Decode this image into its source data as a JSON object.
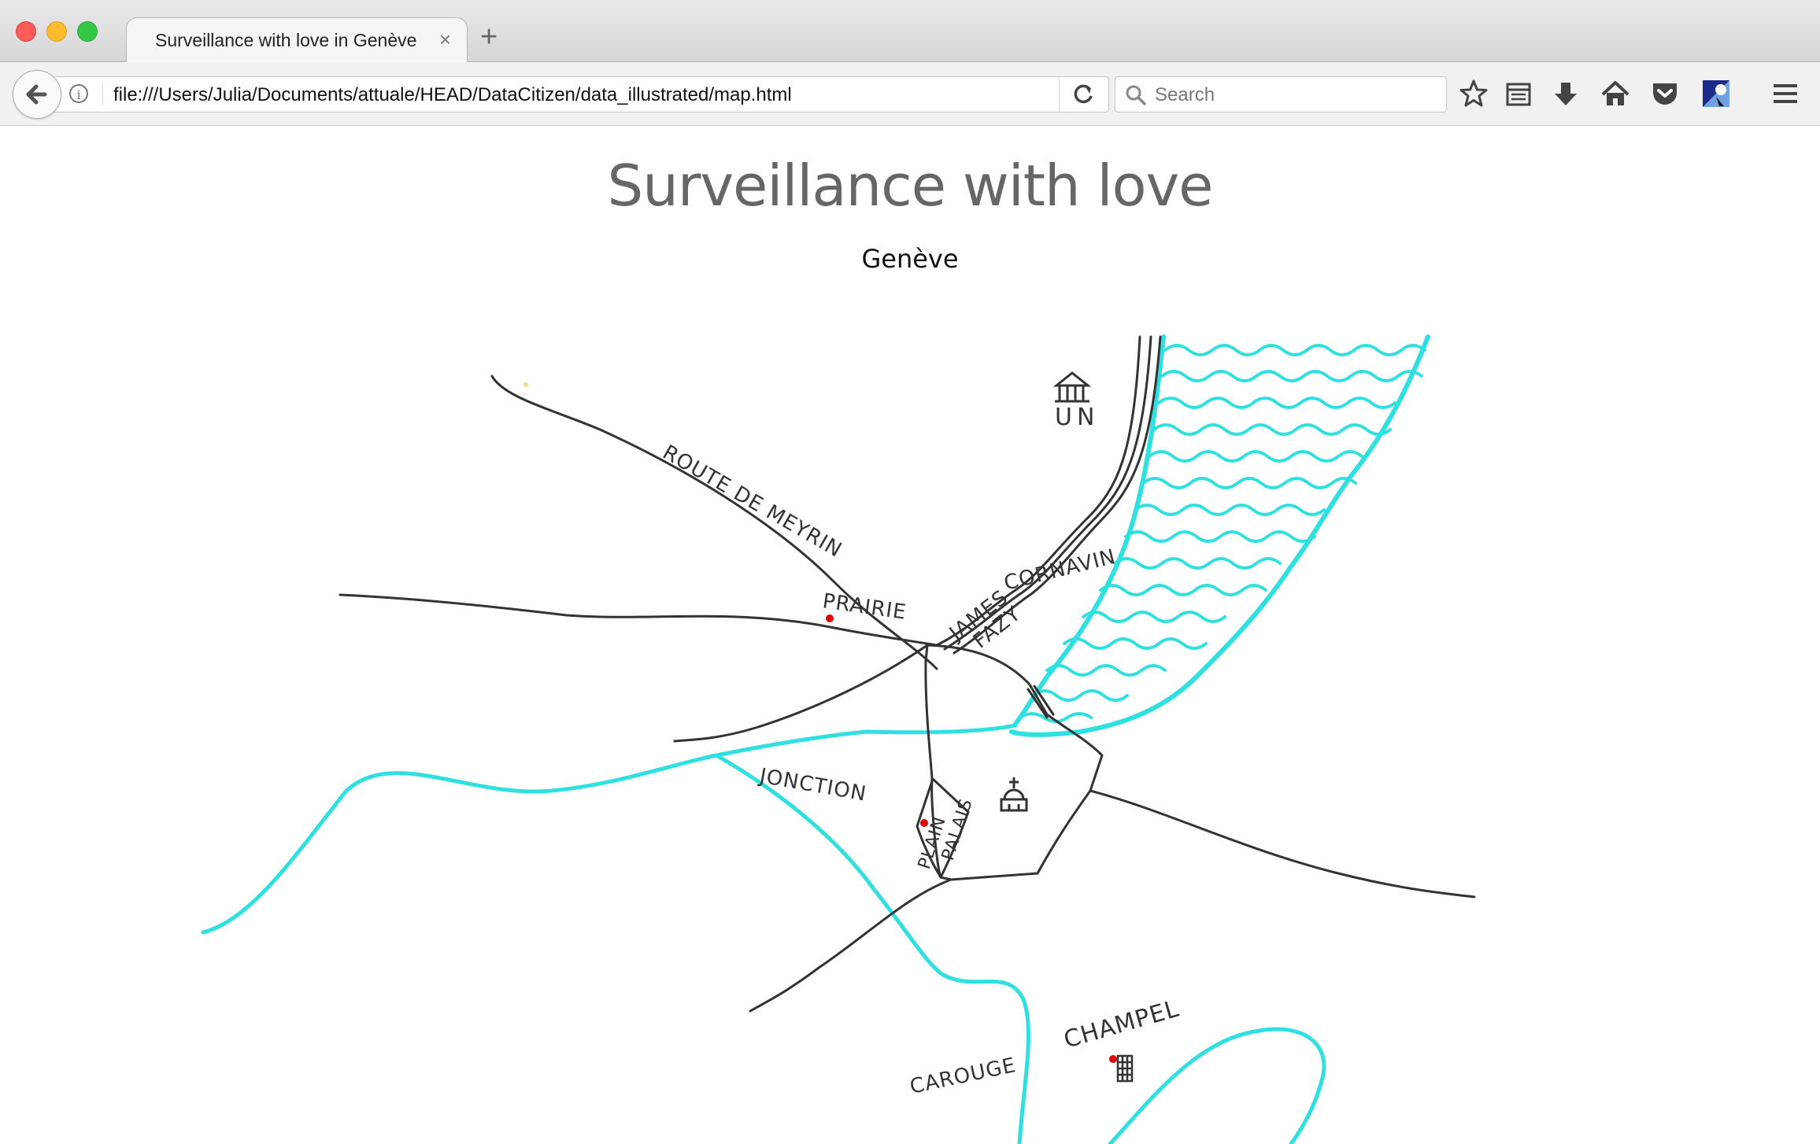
{
  "browser": {
    "tab": {
      "title": "Surveillance with love in Genève"
    },
    "address_bar": {
      "url": "file:///Users/Julia/Documents/attuale/HEAD/DataCitizen/data_illustrated/map.html"
    },
    "search": {
      "placeholder": "Search"
    }
  },
  "page": {
    "title": "Surveillance with love",
    "subtitle": "Genève"
  },
  "map": {
    "labels": {
      "route_de_meyrin": "ROUTE DE MEYRIN",
      "prairie": "PRAIRIE",
      "james": "JAMES",
      "fazy": "FAZY",
      "cornavin": "CORNAVIN",
      "un": "UN",
      "jonction": "JONCTION",
      "plain": "PLAIN",
      "palais": "PALAIS",
      "champel": "CHAMPEL",
      "carouge": "CAROUGE"
    },
    "colors": {
      "river": "#2fe0e0",
      "road": "#333333",
      "camera": "#e00000"
    }
  }
}
